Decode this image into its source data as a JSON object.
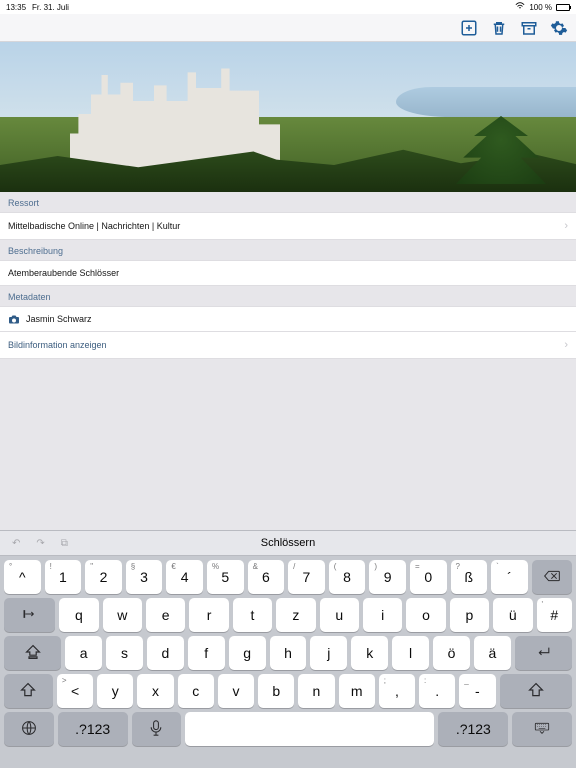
{
  "status": {
    "time": "13:35",
    "date": "Fr. 31. Juli",
    "battery_pct": "100 %"
  },
  "sections": {
    "ressort": {
      "title": "Ressort",
      "value": "Mittelbadische Online | Nachrichten | Kultur"
    },
    "beschreibung": {
      "title": "Beschreibung",
      "value": "Atemberaubende Schlösser"
    },
    "metadaten": {
      "title": "Metadaten",
      "author": "Jasmin Schwarz",
      "info_link": "Bildinformation anzeigen"
    }
  },
  "keyboard": {
    "suggestion": "Schlössern",
    "sym_label": ".?123",
    "row1": [
      {
        "alt": "°",
        "main": "^"
      },
      {
        "alt": "!",
        "main": "1"
      },
      {
        "alt": "\"",
        "main": "2"
      },
      {
        "alt": "§",
        "main": "3"
      },
      {
        "alt": "€",
        "main": "4"
      },
      {
        "alt": "%",
        "main": "5"
      },
      {
        "alt": "&",
        "main": "6"
      },
      {
        "alt": "/",
        "main": "7"
      },
      {
        "alt": "(",
        "main": "8"
      },
      {
        "alt": ")",
        "main": "9"
      },
      {
        "alt": "=",
        "main": "0"
      },
      {
        "alt": "?",
        "main": "ß"
      },
      {
        "alt": "`",
        "main": "´"
      }
    ],
    "row2": [
      "q",
      "w",
      "e",
      "r",
      "t",
      "z",
      "u",
      "i",
      "o",
      "p",
      "ü"
    ],
    "row2_tab_alt": "↹",
    "row2_hash": {
      "alt": "'",
      "main": "#"
    },
    "row3": [
      "a",
      "s",
      "d",
      "f",
      "g",
      "h",
      "j",
      "k",
      "l",
      "ö",
      "ä"
    ],
    "row4_first": {
      "alt": ">",
      "main": "<"
    },
    "row4": [
      "y",
      "x",
      "c",
      "v",
      "b",
      "n",
      "m"
    ],
    "row4_punct": [
      {
        "alt": ";",
        "main": ","
      },
      {
        "alt": ":",
        "main": "."
      },
      {
        "alt": "_",
        "main": "-"
      }
    ]
  }
}
